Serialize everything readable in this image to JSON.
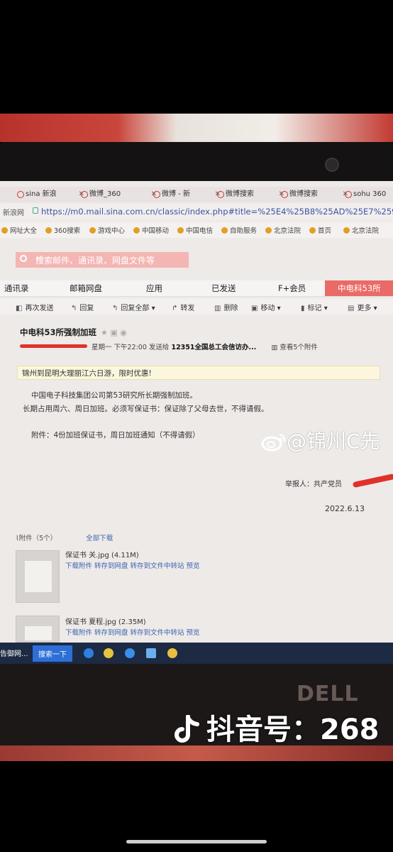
{
  "browser": {
    "tabs": [
      {
        "label": "sina 新浪"
      },
      {
        "label": "微博_360"
      },
      {
        "label": "微博 - 新"
      },
      {
        "label": "微博搜索"
      },
      {
        "label": "微博搜索"
      },
      {
        "label": "sohu 360"
      }
    ],
    "address_home": "新浪网",
    "url": "https://m0.mail.sina.com.cn/classic/index.php#title=%25E4%25B8%25AD%25E7%2594%25B5%",
    "bookmarks": [
      "网址大全",
      "360搜索",
      "游戏中心",
      "中国移动",
      "中国电信",
      "自助服务",
      "北京法院",
      "首页",
      "北京法院"
    ]
  },
  "mail": {
    "search_placeholder": "搜索邮件、通讯录、网盘文件等",
    "nav": [
      "通讯录",
      "邮箱网盘",
      "应用",
      "已发送",
      "F+会员",
      "中电科53所"
    ],
    "toolbar": [
      "再次发送",
      "回复",
      "回复全部",
      "转发",
      "删除",
      "移动",
      "标记",
      "更多"
    ],
    "subject": "中电科53所强制加班",
    "meta_time": "星期一 下午22:00 发送给",
    "meta_to": "12351全国总工会信访办...",
    "meta_view": "查看5个附件",
    "ad": "锦州到昆明大理丽江六日游，限时优惠!",
    "body_line1": "中国电子科技集团公司第53研究所长期强制加班。",
    "body_line2": "长期占用周六、周日加班。必须写保证书：保证除了父母去世，不得请假。",
    "body_line3": "附件：4份加班保证书，周日加班通知（不得请假）",
    "signature": "举报人：共产党员",
    "date": "2022.6.13",
    "attachments_label": "附件（5个）",
    "download_all": "全部下载",
    "files": [
      {
        "name": "保证书 关.jpg (4.11M)",
        "actions": "下载附件  转存到网盘  转存到文件中转站  预览"
      },
      {
        "name": "保证书 夏程.jpg (2.35M)",
        "actions": "下载附件  转存到网盘  转存到文件中转站  预览"
      }
    ]
  },
  "taskbar": {
    "item1": "告御网...",
    "item2": "搜索一下"
  },
  "watermarks": {
    "weibo": "@锦州C先",
    "douyin": "抖音号：268"
  },
  "device_brand": "DELL"
}
